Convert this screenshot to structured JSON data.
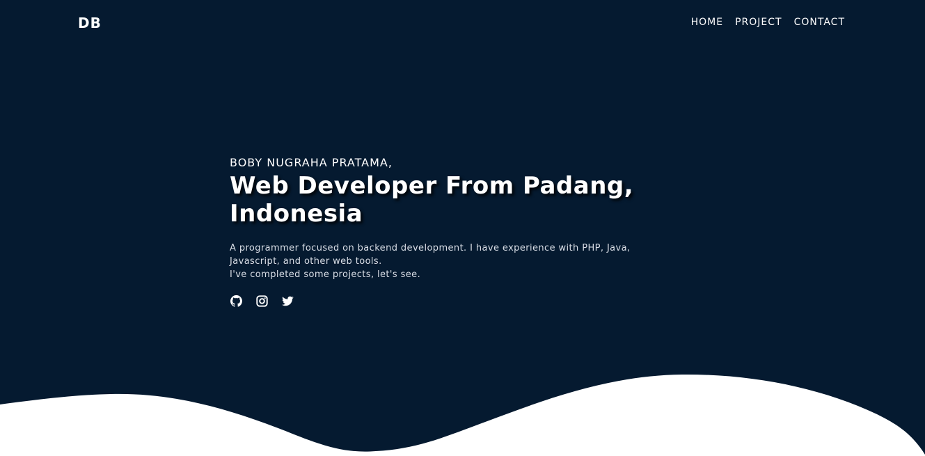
{
  "navbar": {
    "brand": "DB",
    "links": [
      {
        "label": "HOME"
      },
      {
        "label": "PROJECT"
      },
      {
        "label": "CONTACT"
      }
    ]
  },
  "hero": {
    "name": "BOBY NUGRAHA PRATAMA,",
    "title_line1": "Web Developer From Padang,",
    "title_line2": "Indonesia",
    "desc_line1": "A programmer focused on backend development. I have experience with PHP, Java,",
    "desc_line2": "Javascript, and other web tools.",
    "desc_line3": "I've completed some projects, let's see."
  },
  "socials": [
    {
      "icon": "github-icon"
    },
    {
      "icon": "instagram-icon"
    },
    {
      "icon": "twitter-icon"
    }
  ],
  "colors": {
    "background": "#051a30",
    "text": "#ffffff",
    "wave": "#ffffff"
  }
}
